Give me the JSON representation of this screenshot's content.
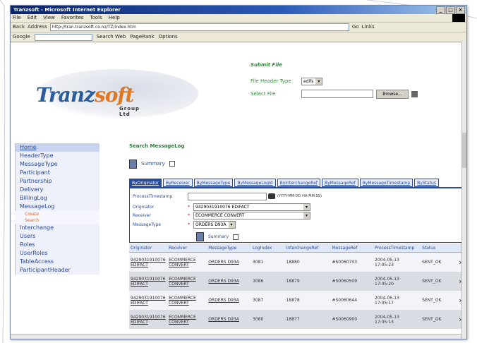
{
  "window": {
    "title": "Tranzsoft - Microsoft Internet Explorer",
    "controls": [
      "_",
      "□",
      "×"
    ]
  },
  "menu": [
    "File",
    "Edit",
    "View",
    "Favorites",
    "Tools",
    "Help"
  ],
  "address": {
    "back": "Back",
    "label": "Address",
    "url": "http://tran.tranzsoft.co.nz/TZ/index.htm",
    "go": "Go",
    "links": "Links"
  },
  "google_bar": {
    "label": "Google",
    "search_web": "Search Web",
    "blocked": "PageRank",
    "options": "Options"
  },
  "logo": {
    "part1": "Tranz",
    "part2": "soft",
    "group": "Group Ltd"
  },
  "submit": {
    "title": "Submit File",
    "file_header_label": "File Header Type",
    "file_header_value": "edifs",
    "select_file_label": "Select File",
    "browse": "Browse..."
  },
  "sidebar": {
    "home": "Home",
    "items": [
      "HeaderType",
      "MessageType",
      "Participant",
      "Partnership",
      "Delivery",
      "BillingLog",
      "MessageLog"
    ],
    "sub_items": [
      "Create",
      "Search"
    ],
    "items2": [
      "Interchange",
      "Users",
      "Roles",
      "UserRoles",
      "TableAccess",
      "ParticipantHeader"
    ]
  },
  "main": {
    "breadcrumb": "Search MessageLog",
    "summary_label": "Summary",
    "tabs": [
      "ByOriginator",
      "ByReceiver",
      "ByMessageType",
      "ByMessageLogId",
      "ByInterchangeRef",
      "ByMessageRef",
      "ByMessageTimestamp",
      "ByStatus"
    ],
    "filters": {
      "timestamp_label": "ProcessTimestamp",
      "timestamp_format": "(YYYY-MM-DD HH:MM:SS)",
      "originator_label": "Originator",
      "originator_value": "9429031910076 EDIFACT",
      "receiver_label": "Receiver",
      "receiver_value": "ECOMMERCE CONVERT",
      "msgtype_label": "MessageType",
      "msgtype_value": "ORDERS D93A",
      "summary_label": "Summary"
    },
    "columns": [
      "Originator",
      "Receiver",
      "MessageType",
      "LogIndex",
      "InterchangeRef",
      "MessageRef",
      "ProcessTimestamp",
      "Status",
      ""
    ],
    "rows": [
      {
        "orig": "9429031910076 EDIFACT",
        "recv": "ECOMMERCE CONVERT",
        "type": "ORDERS D93A",
        "log": "3081",
        "ich": "18880",
        "msg": "#S0060703",
        "ts": "2004-05-13 17:05:23",
        "status": "SENT_OK"
      },
      {
        "orig": "9429031910076 EDIFACT",
        "recv": "ECOMMERCE CONVERT",
        "type": "ORDERS D93A",
        "log": "3086",
        "ich": "18879",
        "msg": "#S0060509",
        "ts": "2004-05-13 17:05:20",
        "status": "SENT_OK"
      },
      {
        "orig": "9429031910076 EDIFACT",
        "recv": "ECOMMERCE CONVERT",
        "type": "ORDERS D93A",
        "log": "3087",
        "ich": "18878",
        "msg": "#S0060644",
        "ts": "2004-05-13 17:05:17",
        "status": "SENT_OK"
      },
      {
        "orig": "9429031910076 EDIFACT",
        "recv": "ECOMMERCE CONVERT",
        "type": "ORDERS D93A",
        "log": "3080",
        "ich": "18877",
        "msg": "#S0060900",
        "ts": "2004-05-13 17:05:13",
        "status": "SENT_OK"
      }
    ]
  }
}
